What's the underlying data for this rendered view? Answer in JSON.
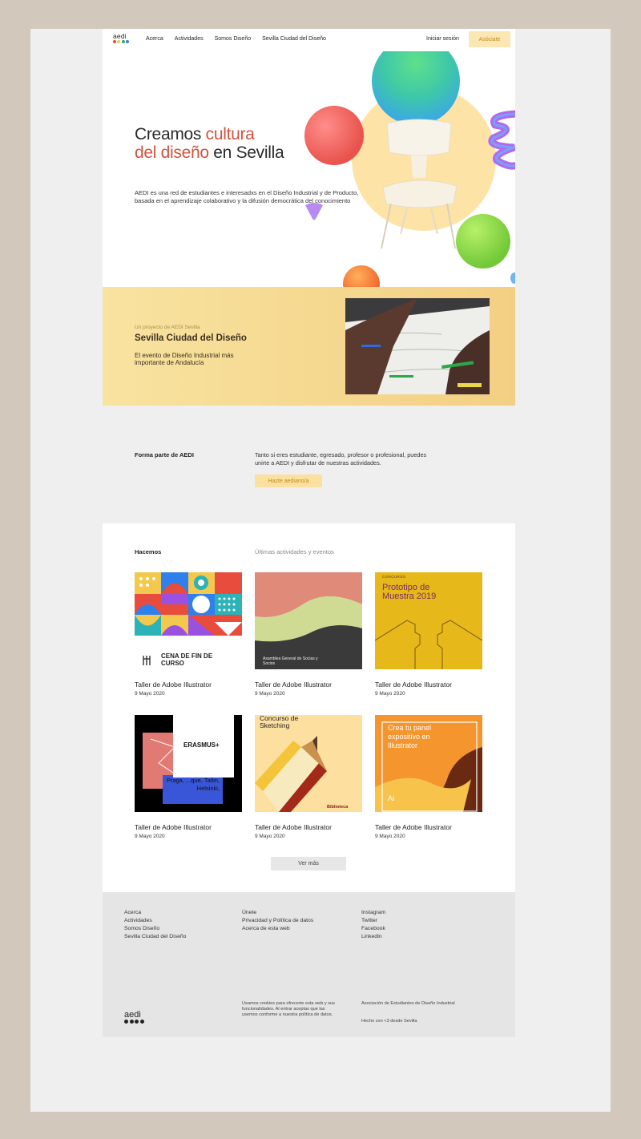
{
  "nav": {
    "logo_text": "aedi",
    "links": [
      "Acerca",
      "Actividades",
      "Somos Diseño",
      "Sevilla Ciudad del Diseño"
    ],
    "login": "Iniciar sesión",
    "join": "Asóciate"
  },
  "brand_colors": [
    "#e74c3c",
    "#f2c94c",
    "#27ae60",
    "#2f80ed"
  ],
  "hero": {
    "title_line1_a": "Creamos ",
    "title_line1_b": "cultura",
    "title_line2_a": "del diseño",
    "title_line2_b": " en Sevilla",
    "text": "AEDI es una red de estudiantes e interesadxs en el Diseño Industrial y de Producto, basada en el aprendizaje colaborativo y la difusión democrática del conocimiento"
  },
  "banner": {
    "kicker": "Un proyecto de AEDI Sevilla",
    "title": "Sevilla Ciudad del Diseño",
    "text": "El evento de Diseño Industrial más importante de Andalucía"
  },
  "join": {
    "title": "Forma parte de AEDI",
    "text": "Tanto si eres estudiante, egresado, profesor o profesional, puedes unirte a AEDI y disfrutar de nuestras actividades.",
    "button": "Hazte aediano/a"
  },
  "activities": {
    "label": "Hacemos",
    "subtitle": "Últimas actividades y eventos",
    "cards": [
      {
        "title": "Taller de Adobe Illustrator",
        "date": "9 Mayo 2020",
        "img_text": "CENA DE FIN DE CURSO"
      },
      {
        "title": "Taller de Adobe Illustrator",
        "date": "9 Mayo 2020",
        "img_text": "Asamblea General de Socias y Socios"
      },
      {
        "title": "Taller de Adobe Illustrator",
        "date": "9 Mayo 2020",
        "img_kicker": "CONCURSO",
        "img_text": "Prototipo de Muestra 2019"
      },
      {
        "title": "Taller de Adobe Illustrator",
        "date": "9 Mayo 2020",
        "img_text": "ERASMUS+",
        "img_cities": "Praga, ...que, Tallin, Helsinki,"
      },
      {
        "title": "Taller de Adobe Illustrator",
        "date": "9 Mayo 2020",
        "img_text": "Concurso de Sketching",
        "img_badge": "Biblioteca"
      },
      {
        "title": "Taller de Adobe Illustrator",
        "date": "9 Mayo 2020",
        "img_text": "Crea tu panel expositivo en Illustrator",
        "img_badge": "Ai"
      }
    ],
    "more": "Ver más"
  },
  "footer": {
    "col1": [
      "Acerca",
      "Actividades",
      "Somos Diseño",
      "Sevilla Ciudad del Diseño"
    ],
    "col2": [
      "Únete",
      "Privacidad y Política de datos",
      "Acerca de esta web"
    ],
    "col3": [
      "Instagram",
      "Twitter",
      "Facebook",
      "LinkedIn"
    ],
    "cookies": "Usamos cookies para ofrecerte esta web y sus funcionalidades. Al entrar aceptas que las usemos conforme a nuestra política de datos.",
    "association": "Asociación de Estudiantes de Diseño Industrial",
    "made": "Hecho con <3 desde Sevilla",
    "logo_text": "aedi"
  }
}
